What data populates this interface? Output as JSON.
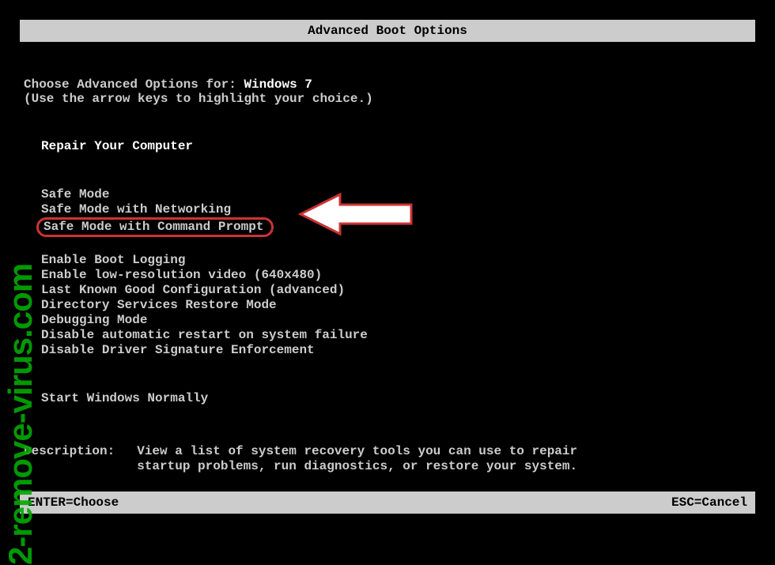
{
  "title": "Advanced Boot Options",
  "intro": {
    "prefix": "Choose Advanced Options for: ",
    "os": "Windows 7",
    "hint": "(Use the arrow keys to highlight your choice.)"
  },
  "group1": [
    "Repair Your Computer"
  ],
  "group2": [
    "Safe Mode",
    "Safe Mode with Networking",
    "Safe Mode with Command Prompt"
  ],
  "group3": [
    "Enable Boot Logging",
    "Enable low-resolution video (640x480)",
    "Last Known Good Configuration (advanced)",
    "Directory Services Restore Mode",
    "Debugging Mode",
    "Disable automatic restart on system failure",
    "Disable Driver Signature Enforcement"
  ],
  "group4": [
    "Start Windows Normally"
  ],
  "description": {
    "label": "Description:",
    "text": "View a list of system recovery tools you can use to repair startup problems, run diagnostics, or restore your system."
  },
  "footer": {
    "enter": "ENTER=Choose",
    "esc": "ESC=Cancel"
  },
  "watermark": "2-remove-virus.com"
}
